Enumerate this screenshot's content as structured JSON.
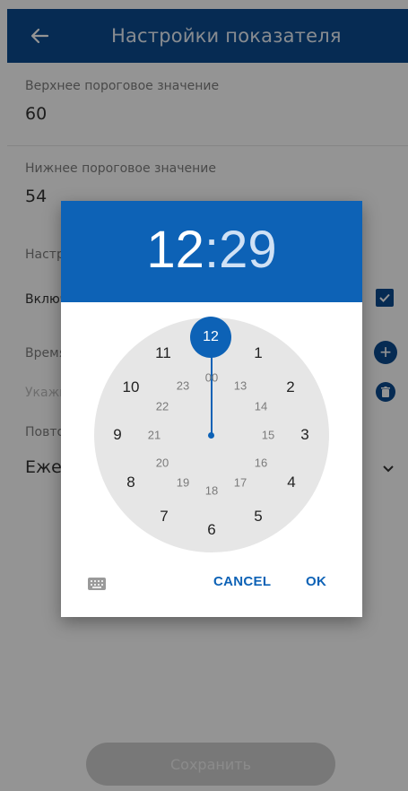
{
  "appbar": {
    "title": "Настройки показателя"
  },
  "form": {
    "upper_label": "Верхнее пороговое значение",
    "upper_value": "60",
    "lower_label": "Нижнее пороговое значение",
    "lower_value": "54",
    "section_label_partial": "Настр",
    "enable_label_partial": "Включ",
    "time_label_partial": "Время",
    "time_placeholder_partial": "Укажи",
    "repeat_label_partial": "Повто",
    "repeat_value_partial": "Ежед",
    "save_label": "Сохранить"
  },
  "dialog": {
    "hour": "12",
    "colon": ":",
    "minute": "29",
    "outer_numbers": [
      "12",
      "1",
      "2",
      "3",
      "4",
      "5",
      "6",
      "7",
      "8",
      "9",
      "10",
      "11"
    ],
    "inner_numbers": [
      "00",
      "13",
      "14",
      "15",
      "16",
      "17",
      "18",
      "19",
      "20",
      "21",
      "22",
      "23"
    ],
    "cancel_label": "CANCEL",
    "ok_label": "OK"
  },
  "colors": {
    "appbar": "#0b4a8f",
    "dialog_header": "#0d62b6",
    "clock_face": "#e6e6e6"
  }
}
